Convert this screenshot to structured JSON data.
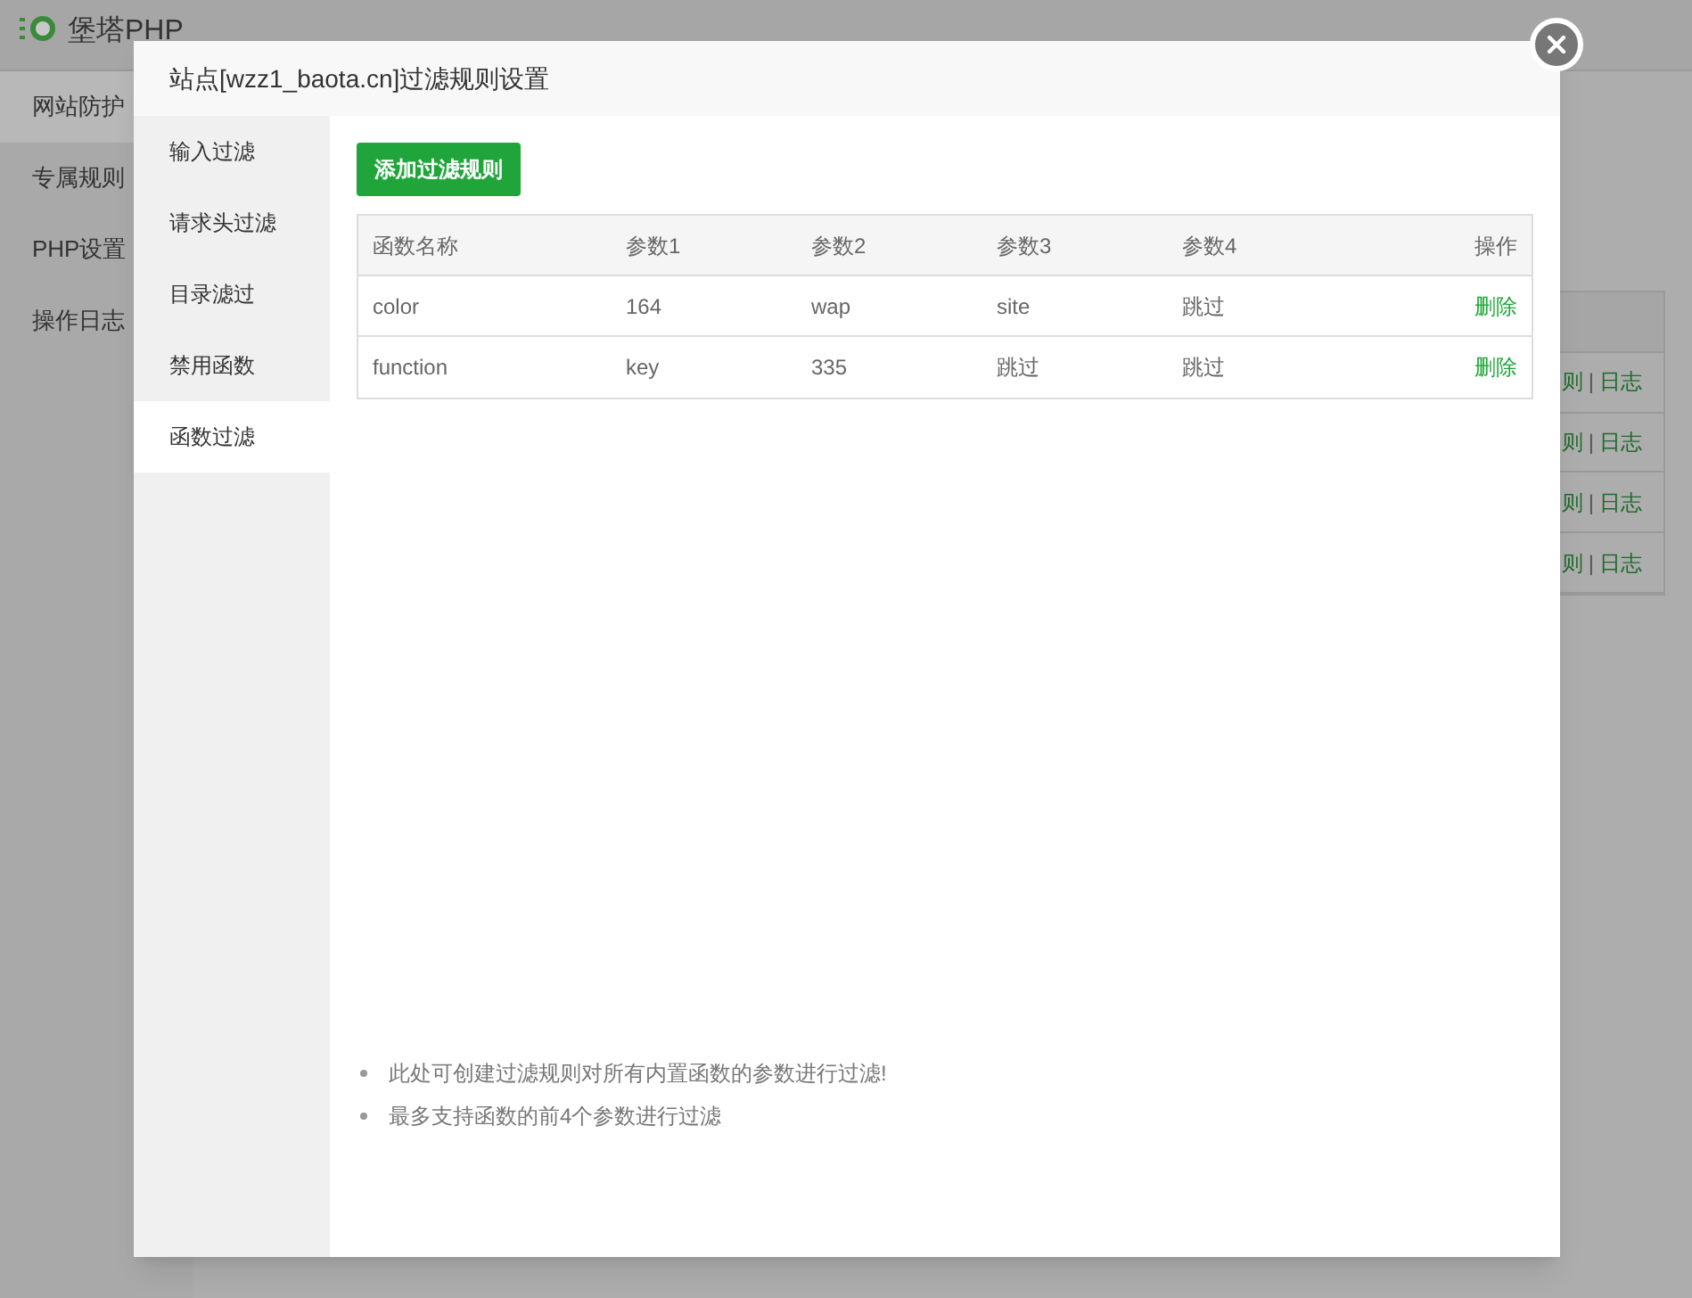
{
  "app": {
    "title": "堡塔PHP"
  },
  "sidebar": {
    "items": [
      {
        "label": "网站防护",
        "selected": true
      },
      {
        "label": "专属规则",
        "selected": false
      },
      {
        "label": "PHP设置",
        "selected": false
      },
      {
        "label": "操作日志",
        "selected": false
      }
    ]
  },
  "background_table": {
    "rows": [
      {
        "rule_link": "则",
        "separator": "|",
        "log_link": "日志"
      },
      {
        "rule_link": "则",
        "separator": "|",
        "log_link": "日志"
      },
      {
        "rule_link": "则",
        "separator": "|",
        "log_link": "日志"
      },
      {
        "rule_link": "则",
        "separator": "|",
        "log_link": "日志"
      }
    ]
  },
  "dialog": {
    "title": "站点[wzz1_baota.cn]过滤规则设置",
    "tabs": [
      {
        "label": "输入过滤",
        "selected": false
      },
      {
        "label": "请求头过滤",
        "selected": false
      },
      {
        "label": "目录滤过",
        "selected": false
      },
      {
        "label": "禁用函数",
        "selected": false
      },
      {
        "label": "函数过滤",
        "selected": true
      }
    ],
    "add_button": "添加过滤规则",
    "table": {
      "columns": [
        "函数名称",
        "参数1",
        "参数2",
        "参数3",
        "参数4",
        "操作"
      ],
      "rows": [
        {
          "cells": [
            "color",
            "164",
            "wap",
            "site",
            "跳过"
          ],
          "action": "删除"
        },
        {
          "cells": [
            "function",
            "key",
            "335",
            "跳过",
            "跳过"
          ],
          "action": "删除"
        }
      ]
    },
    "notes": [
      "此处可创建过滤规则对所有内置函数的参数进行过滤!",
      "最多支持函数的前4个参数进行过滤"
    ]
  }
}
